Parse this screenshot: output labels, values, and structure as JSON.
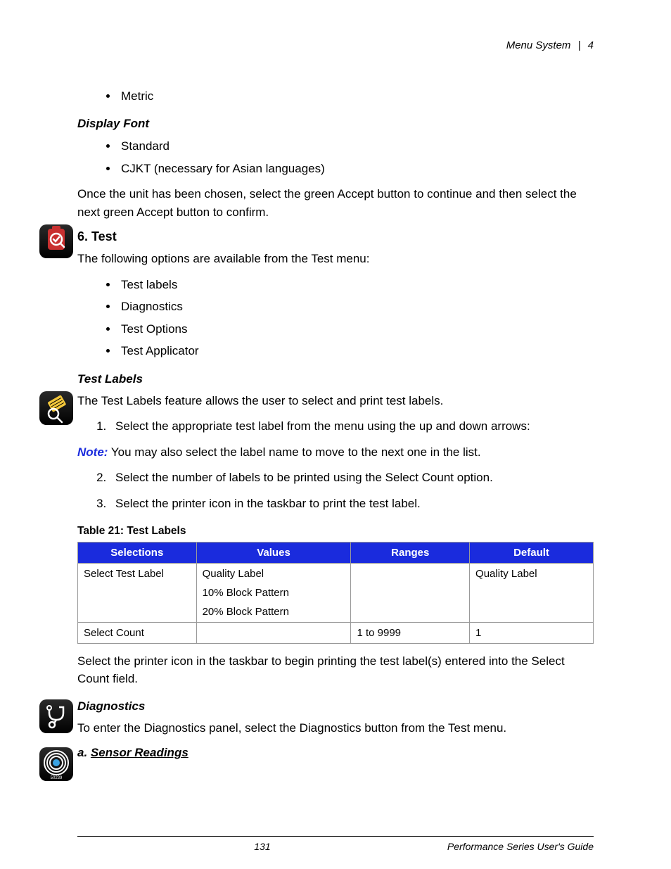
{
  "header": {
    "section": "Menu System",
    "chapter": "4"
  },
  "metric_item": "Metric",
  "display_font": {
    "heading": "Display Font",
    "items": [
      "Standard",
      "CJKT (necessary for Asian languages)"
    ],
    "after": "Once the unit has been chosen, select the green Accept button to continue and then select the next green Accept button to confirm."
  },
  "test": {
    "heading": "6. Test",
    "intro": "The following options are available from the Test menu:",
    "items": [
      "Test labels",
      "Diagnostics",
      "Test Options",
      "Test Applicator"
    ]
  },
  "test_labels": {
    "heading": "Test Labels",
    "intro": "The Test Labels feature allows the user to select and print test labels.",
    "step1": "Select the appropriate test label from the menu using the up and down arrows:",
    "note_label": "Note:",
    "note_text": " You may also select the label name to move to the next one in the list.",
    "step2": "Select the number of labels to be printed using the Select Count option.",
    "step3": "Select the printer icon in the taskbar to print the test label.",
    "table_caption": "Table 21: Test Labels",
    "table_headers": [
      "Selections",
      "Values",
      "Ranges",
      "Default"
    ],
    "table_rows": [
      {
        "sel": "Select Test Label",
        "vals": [
          "Quality Label",
          "10% Block Pattern",
          "20% Block Pattern"
        ],
        "range": "",
        "def": "Quality Label"
      },
      {
        "sel": "Select Count",
        "vals": [
          ""
        ],
        "range": "1 to 9999",
        "def": "1"
      }
    ],
    "after_table": "Select the printer icon in the taskbar to begin printing the test label(s) entered into the Select Count field."
  },
  "diagnostics": {
    "heading": "Diagnostics",
    "intro": "To enter the Diagnostics panel, select the Diagnostics button from the Test menu.",
    "sub_prefix": "a. ",
    "sub": "Sensor Readings",
    "sensor_code": "50239"
  },
  "footer": {
    "page": "131",
    "book": "Performance Series User's Guide"
  }
}
